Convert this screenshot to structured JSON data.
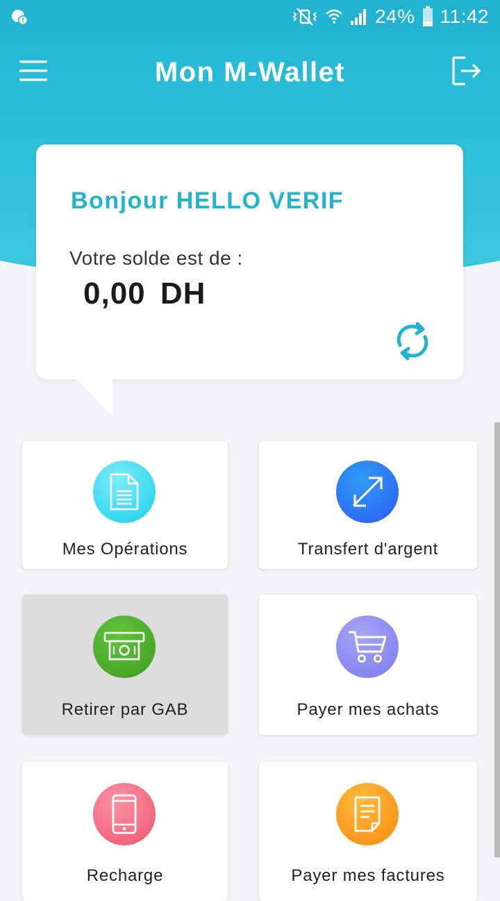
{
  "status_bar": {
    "battery_percent": "24%",
    "time": "11:42",
    "icons": [
      "notification-icon",
      "mute-vibrate-icon",
      "wifi-icon",
      "signal-icon",
      "battery-icon"
    ]
  },
  "header": {
    "title": "Mon M-Wallet",
    "menu_icon": "hamburger-menu-icon",
    "logout_icon": "logout-icon"
  },
  "balance_card": {
    "greeting": "Bonjour HELLO VERIF",
    "balance_label": "Votre solde est de :",
    "balance_amount": "0,00",
    "balance_currency": "DH",
    "refresh_icon": "refresh-icon"
  },
  "tiles": [
    {
      "label": "Mes Opérations",
      "icon": "document-icon",
      "color": "#2fd3ea"
    },
    {
      "label": "Transfert d'argent",
      "icon": "transfer-arrows-icon",
      "color": "#2f6ef7"
    },
    {
      "label": "Retirer par GAB",
      "icon": "cash-withdrawal-icon",
      "color": "#4fae2a"
    },
    {
      "label": "Payer mes achats",
      "icon": "shopping-cart-icon",
      "color": "#8a88f2"
    },
    {
      "label": "Recharge",
      "icon": "smartphone-icon",
      "color": "#f46a82"
    },
    {
      "label": "Payer mes factures",
      "icon": "bill-icon",
      "color": "#fb9a14"
    }
  ],
  "colors": {
    "primary": "#22b3d3",
    "background": "#f3f4f6",
    "card": "#ffffff"
  }
}
